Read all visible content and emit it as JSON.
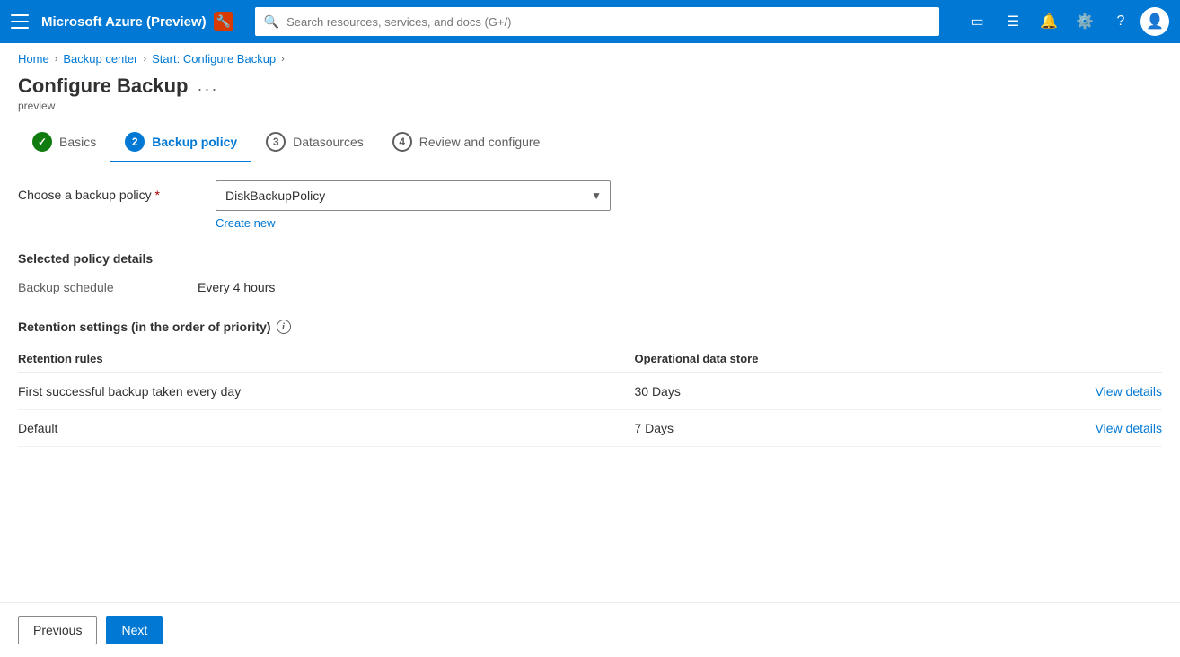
{
  "topbar": {
    "title": "Microsoft Azure (Preview)",
    "badge": "🔧",
    "search_placeholder": "Search resources, services, and docs (G+/)"
  },
  "breadcrumb": {
    "items": [
      "Home",
      "Backup center",
      "Start: Configure Backup"
    ]
  },
  "page": {
    "title": "Configure Backup",
    "subtitle": "preview"
  },
  "tabs": [
    {
      "num": "1",
      "label": "Basics",
      "state": "completed"
    },
    {
      "num": "2",
      "label": "Backup policy",
      "state": "active"
    },
    {
      "num": "3",
      "label": "Datasources",
      "state": "inactive"
    },
    {
      "num": "4",
      "label": "Review and configure",
      "state": "inactive"
    }
  ],
  "form": {
    "policy_label": "Choose a backup policy",
    "policy_required": true,
    "policy_value": "DiskBackupPolicy",
    "policy_options": [
      "DiskBackupPolicy"
    ],
    "create_new_label": "Create new"
  },
  "policy_details": {
    "section_title": "Selected policy details",
    "backup_schedule_label": "Backup schedule",
    "backup_schedule_value": "Every 4 hours"
  },
  "retention": {
    "section_title": "Retention settings (in the order of priority)",
    "has_info": true,
    "columns": [
      "Retention rules",
      "Operational data store",
      ""
    ],
    "rows": [
      {
        "rule": "First successful backup taken every day",
        "store": "30 Days",
        "link": "View details"
      },
      {
        "rule": "Default",
        "store": "7 Days",
        "link": "View details"
      }
    ]
  },
  "footer": {
    "previous_label": "Previous",
    "next_label": "Next"
  }
}
